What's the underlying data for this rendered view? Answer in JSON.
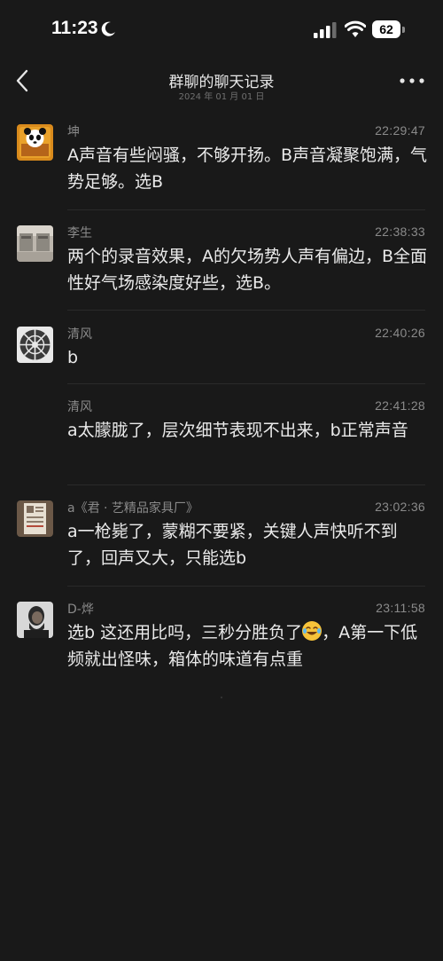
{
  "status": {
    "time": "11:23",
    "battery": "62"
  },
  "nav": {
    "title": "群聊的聊天记录",
    "subtitle": "2024 年 01 月 01 日"
  },
  "messages": [
    {
      "sender": "坤",
      "time": "22:29:47",
      "text": "A声音有些闷骚，不够开扬。B声音凝聚饱满，气势足够。选B"
    },
    {
      "sender": "李生",
      "time": "22:38:33",
      "text": "两个的录音效果，A的欠场势人声有偏边，B全面性好气场感染度好些，选B。"
    },
    {
      "sender": "清风",
      "time": "22:40:26",
      "text": "b"
    },
    {
      "sender": "清风",
      "time": "22:41:28",
      "text": "a太朦胧了，层次细节表现不出来，b正常声音"
    },
    {
      "sender": "a《君 · 艺精品家具厂》",
      "time": "23:02:36",
      "text": "a一枪毙了，蒙糊不要紧，关键人声快听不到了，回声又大，只能选b"
    },
    {
      "sender": "D-烨",
      "time": "23:11:58",
      "text_before": "选b  这还用比吗，三秒分胜负了",
      "text_after": "，A第一下低频就出怪味，箱体的味道有点重"
    }
  ],
  "icons": {
    "back": "chevron-left-icon",
    "more": "more-dots-icon",
    "moon": "moon-icon",
    "signal": "cellular-signal-icon",
    "wifi": "wifi-icon",
    "emoji": "laughing-tears-emoji"
  },
  "colors": {
    "background": "#191919",
    "text": "#eaeaea",
    "meta": "#8a8a8a"
  }
}
